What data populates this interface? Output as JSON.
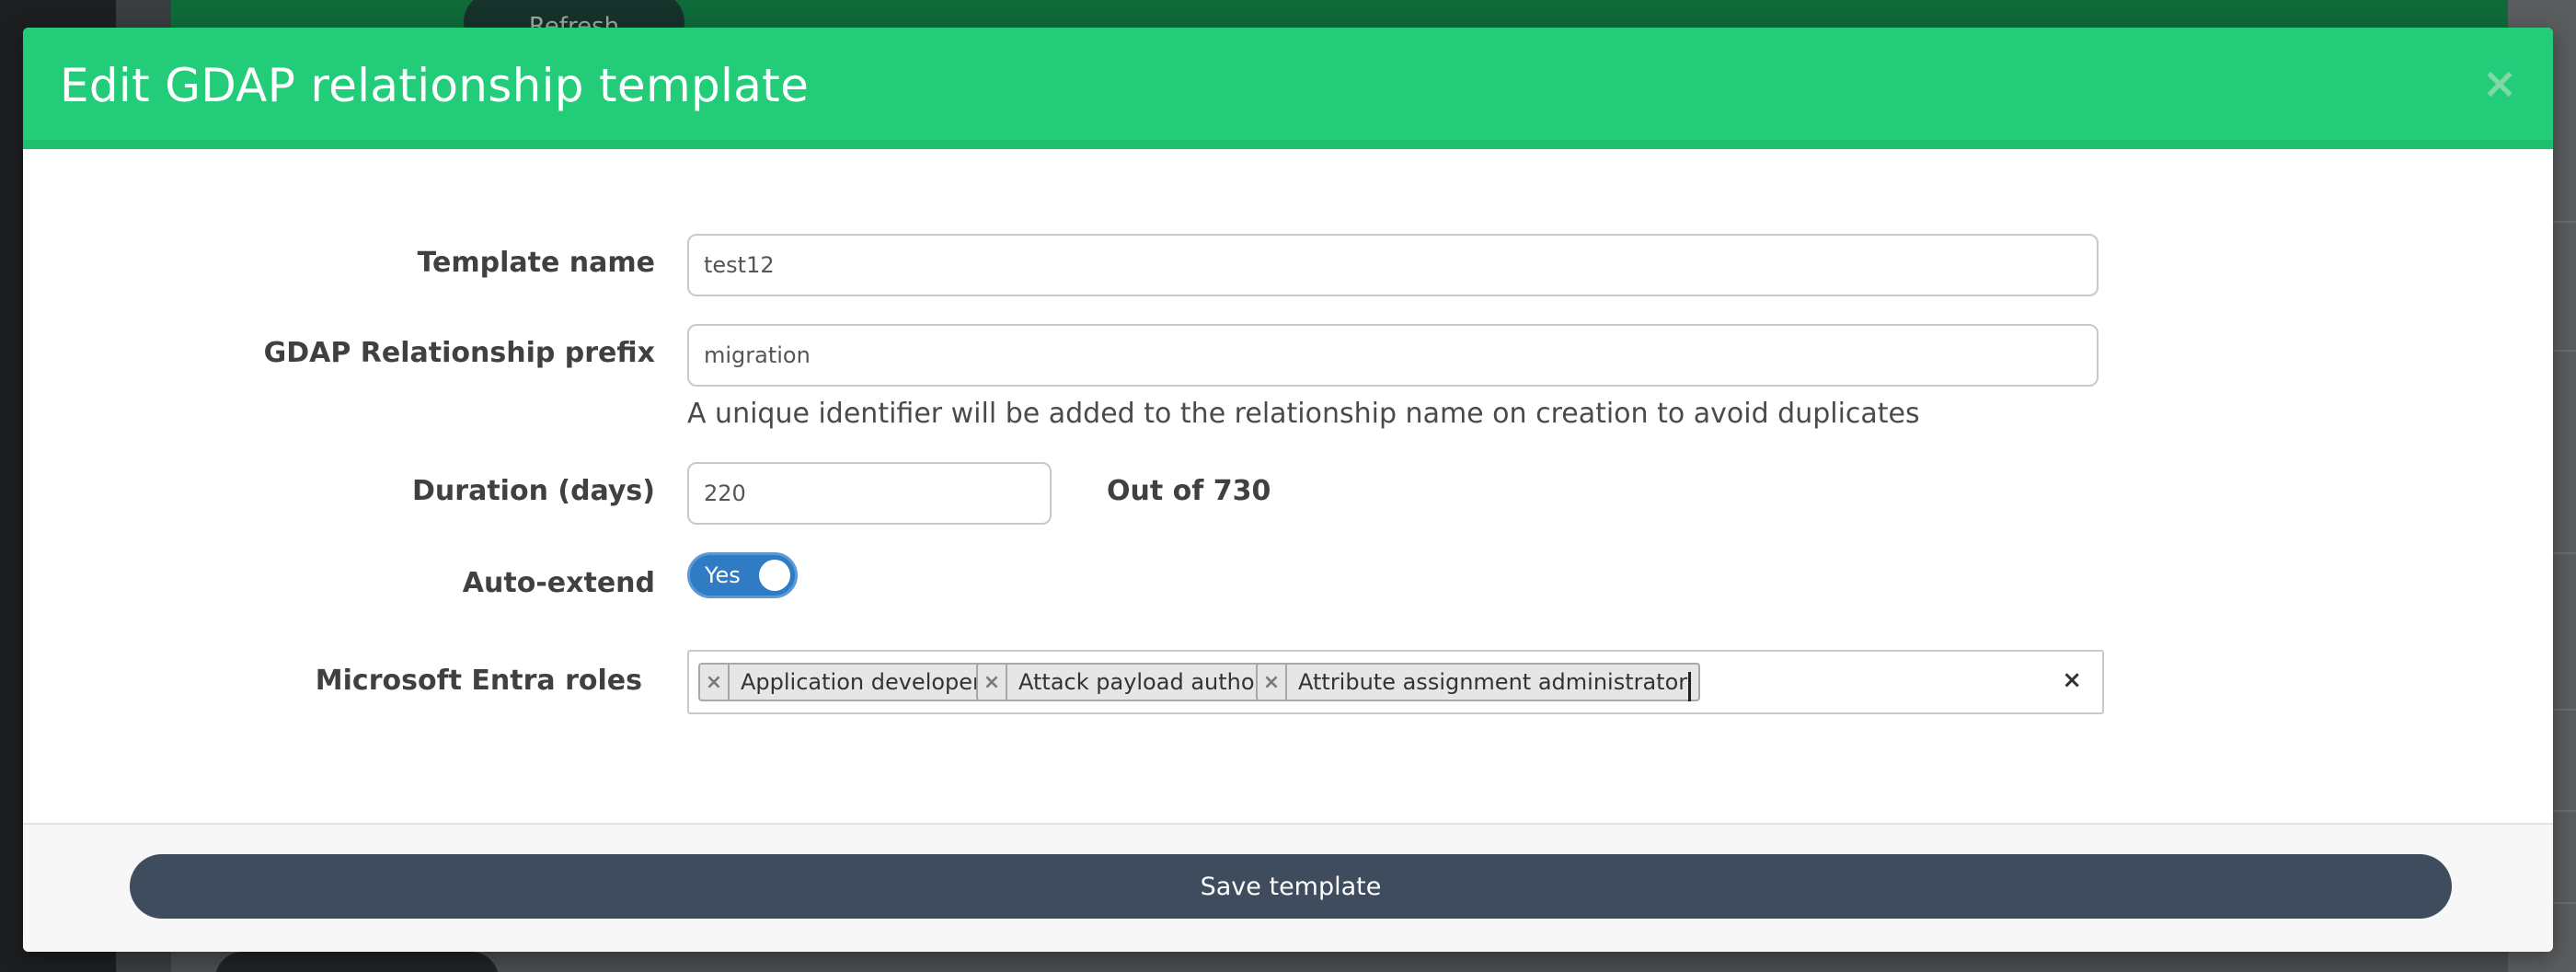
{
  "background": {
    "refresh_label": "Refresh"
  },
  "modal": {
    "title": "Edit GDAP relationship template",
    "close_symbol": "×"
  },
  "form": {
    "template_name": {
      "label": "Template name",
      "value": "test12"
    },
    "prefix": {
      "label": "GDAP Relationship prefix",
      "value": "migration",
      "help": "A unique identifier will be added to the relationship name on creation to avoid duplicates"
    },
    "duration": {
      "label": "Duration (days)",
      "value": "220",
      "max_text": "Out of 730"
    },
    "auto_extend": {
      "label": "Auto-extend",
      "toggle_text": "Yes",
      "enabled": true
    },
    "roles": {
      "label": "Microsoft Entra roles",
      "selected": [
        "Application developer",
        "Attack payload author",
        "Attribute assignment administrator"
      ],
      "chip_remove_symbol": "×",
      "clear_symbol": "×"
    }
  },
  "footer": {
    "save_label": "Save template"
  },
  "colors": {
    "header_green": "#22cc78",
    "toggle_blue": "#2f7bc4",
    "save_button": "#3e4c5e"
  }
}
